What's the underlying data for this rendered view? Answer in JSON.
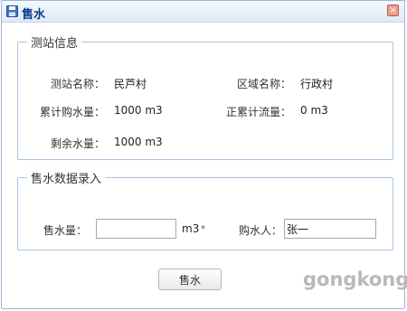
{
  "dialog": {
    "title": "售水",
    "close_glyph": "×",
    "icon": "save-icon"
  },
  "station_info": {
    "legend": "测站信息",
    "station_name_label": "测站名称：",
    "station_name_value": "民芦村",
    "region_name_label": "区域名称：",
    "region_name_value": "行政村",
    "total_purchase_label": "累计购水量：",
    "total_purchase_value": "1000 m3",
    "positive_flow_label": "正累计流量：",
    "positive_flow_value": "0 m3",
    "remaining_label": "剩余水量：",
    "remaining_value": "1000 m3"
  },
  "sale_entry": {
    "legend": "售水数据录入",
    "quantity_label": "售水量：",
    "quantity_value": "",
    "quantity_unit": "m3",
    "required_mark": "*",
    "buyer_label": "购水人：",
    "buyer_value": "张一"
  },
  "submit_label": "售水",
  "watermark": "gongkong",
  "colors": {
    "title_text": "#0b3c88",
    "fieldset_border": "#a9c3e2",
    "close_button": "#e8a08f"
  }
}
